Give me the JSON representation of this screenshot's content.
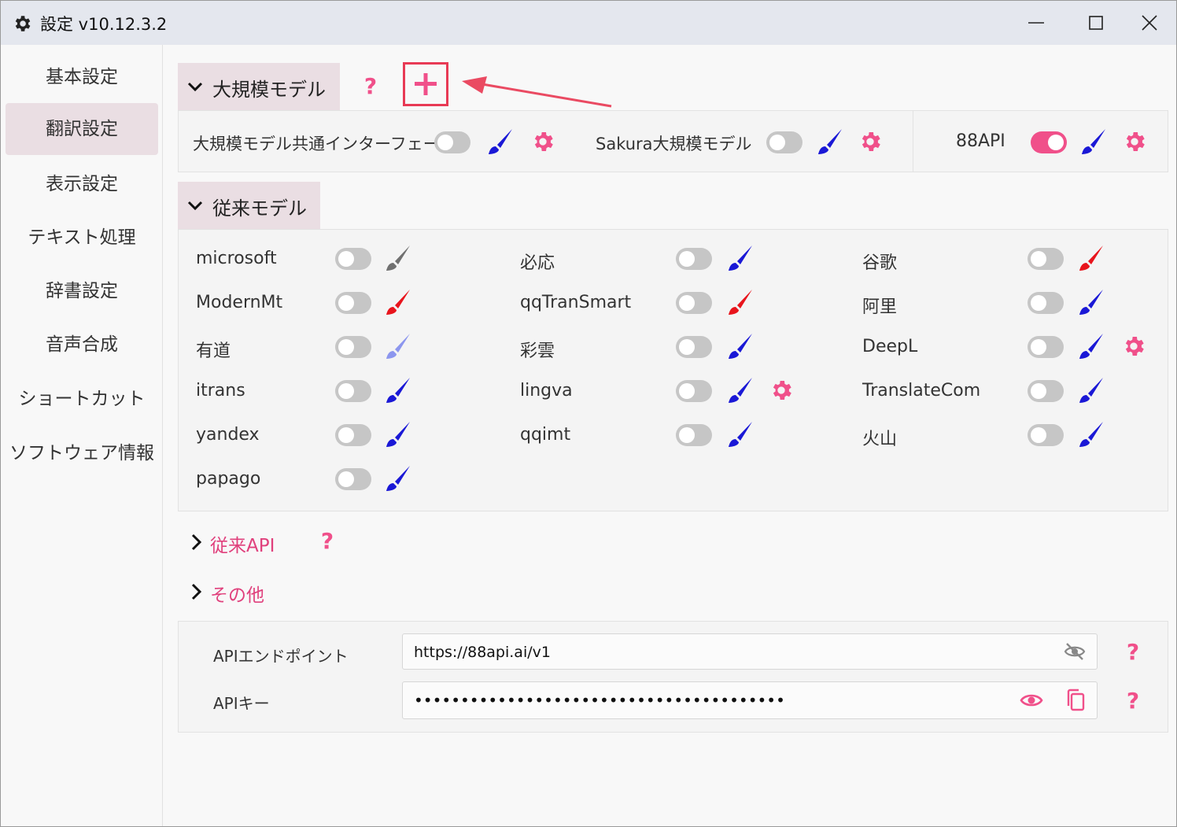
{
  "window": {
    "title": "設定 v10.12.3.2"
  },
  "sidebar": {
    "items": [
      {
        "label": "基本設定"
      },
      {
        "label": "翻訳設定"
      },
      {
        "label": "表示設定"
      },
      {
        "label": "テキスト処理"
      },
      {
        "label": "辞書設定"
      },
      {
        "label": "音声合成"
      },
      {
        "label": "ショートカット"
      },
      {
        "label": "ソフトウェア情報"
      }
    ],
    "active_index": 1
  },
  "llm": {
    "title": "大規模モデル",
    "items": [
      {
        "label": "大規模モデル共通インターフェース",
        "on": false
      },
      {
        "label": "Sakura大規模モデル",
        "on": false
      },
      {
        "label": "88API",
        "on": true
      }
    ]
  },
  "traditional": {
    "title": "従来モデル",
    "items": [
      {
        "label": "microsoft",
        "brush_color": "#707070"
      },
      {
        "label": "必応",
        "brush_color": "#1a18d6"
      },
      {
        "label": "谷歌",
        "brush_color": "#e8141c"
      },
      {
        "label": "ModernMt",
        "brush_color": "#e8141c"
      },
      {
        "label": "qqTranSmart",
        "brush_color": "#e8141c"
      },
      {
        "label": "阿里",
        "brush_color": "#1a18d6"
      },
      {
        "label": "有道",
        "brush_color": "#8c96ee"
      },
      {
        "label": "彩雲",
        "brush_color": "#1a18d6"
      },
      {
        "label": "DeepL",
        "brush_color": "#1a18d6"
      },
      {
        "label": "itrans",
        "brush_color": "#1a18d6"
      },
      {
        "label": "lingva",
        "brush_color": "#1a18d6"
      },
      {
        "label": "TranslateCom",
        "brush_color": "#1a18d6"
      },
      {
        "label": "yandex",
        "brush_color": "#1a18d6"
      },
      {
        "label": "qqimt",
        "brush_color": "#1a18d6"
      },
      {
        "label": "火山",
        "brush_color": "#1a18d6"
      },
      {
        "label": "papago",
        "brush_color": "#1a18d6"
      }
    ]
  },
  "sections": {
    "legacy_api": "従来API",
    "others": "その他"
  },
  "api": {
    "endpoint_label": "APIエンドポイント",
    "endpoint_value": "https://88api.ai/v1",
    "key_label": "APIキー",
    "key_value": "••••••••••••••••••••••••••••••••••••••••"
  },
  "colors": {
    "accent": "#f0508a",
    "brush_blue": "#1a18d6",
    "highlight_red": "#e83a55"
  }
}
